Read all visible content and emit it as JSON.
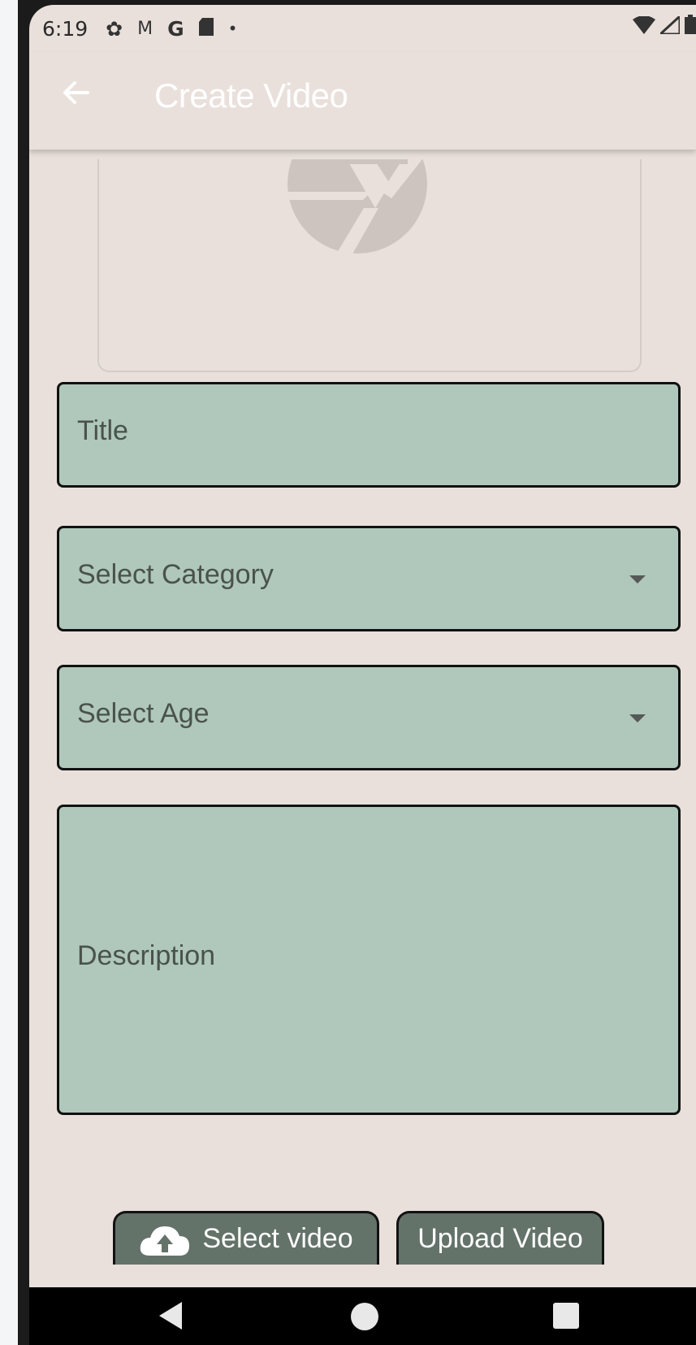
{
  "status_bar": {
    "time": "6:19",
    "icons": [
      "gear-icon",
      "gmail-icon",
      "google-icon",
      "sd-card-icon",
      "dot-icon"
    ],
    "right_icons": [
      "wifi-icon",
      "signal-icon",
      "battery-icon"
    ]
  },
  "app_bar": {
    "title": "Create Video",
    "back_icon": "arrow-left-icon"
  },
  "image_placeholder": {
    "icon": "camera-aperture-icon"
  },
  "form": {
    "title_placeholder": "Title",
    "category_placeholder": "Select Category",
    "age_placeholder": "Select Age",
    "description_placeholder": "Description"
  },
  "actions": {
    "select_video_label": "Select video",
    "select_video_icon": "cloud-upload-icon",
    "upload_video_label": "Upload Video"
  },
  "colors": {
    "background": "#e9e0db",
    "field_fill": "#afc8bb",
    "button_fill": "#647369",
    "app_title": "#ffffff"
  }
}
